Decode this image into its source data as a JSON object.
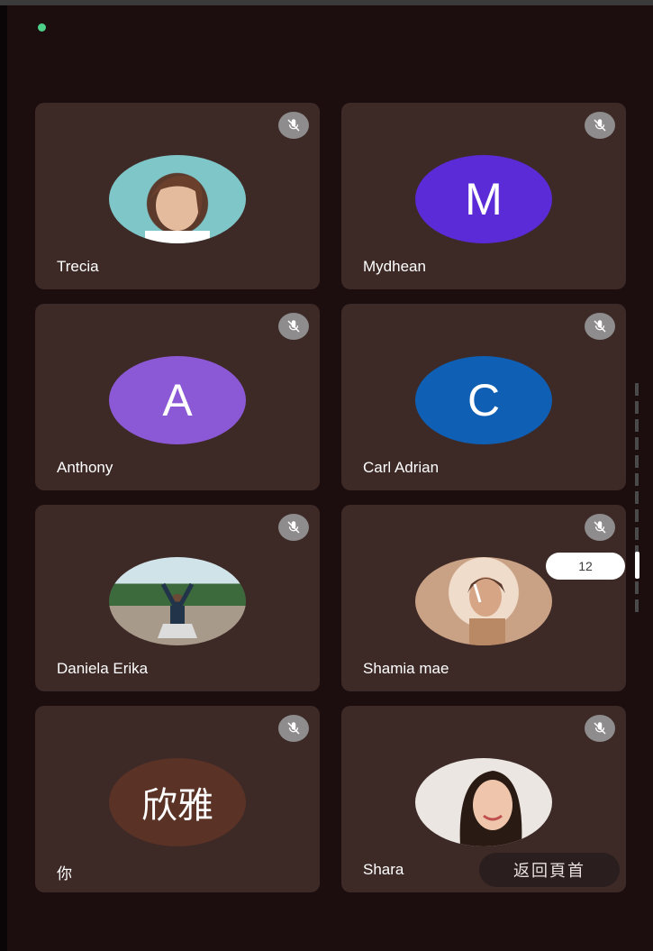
{
  "participants": [
    {
      "name": "Trecia",
      "avatar_kind": "photo",
      "avatar_text": "",
      "avatar_color": "#6fb9c1",
      "muted": true
    },
    {
      "name": "Mydhean",
      "avatar_kind": "letter",
      "avatar_text": "M",
      "avatar_color": "#5a2bd6",
      "muted": true
    },
    {
      "name": "Anthony",
      "avatar_kind": "letter",
      "avatar_text": "A",
      "avatar_color": "#8c59d6",
      "muted": true
    },
    {
      "name": "Carl Adrian",
      "avatar_kind": "letter",
      "avatar_text": "C",
      "avatar_color": "#0f5fb4",
      "muted": true
    },
    {
      "name": "Daniela Erika",
      "avatar_kind": "photo",
      "avatar_text": "",
      "avatar_color": "#5f8a5a",
      "muted": true
    },
    {
      "name": "Shamia mae",
      "avatar_kind": "photo",
      "avatar_text": "",
      "avatar_color": "#d8b8a2",
      "muted": true
    },
    {
      "name": "你",
      "avatar_kind": "text",
      "avatar_text": "欣雅",
      "avatar_color": "#5a3226",
      "muted": true
    },
    {
      "name": "Shara",
      "avatar_kind": "photo",
      "avatar_text": "",
      "avatar_color": "#e9e3df",
      "muted": true
    }
  ],
  "page_indicator": "12",
  "back_to_top_label": "返回頁首",
  "icons": {
    "mic_off": "mic-off-icon",
    "status_dot": "status-dot-icon"
  },
  "colors": {
    "background": "#1c0e0f",
    "tile": "#3d2a27",
    "status_dot": "#4fd08a"
  }
}
